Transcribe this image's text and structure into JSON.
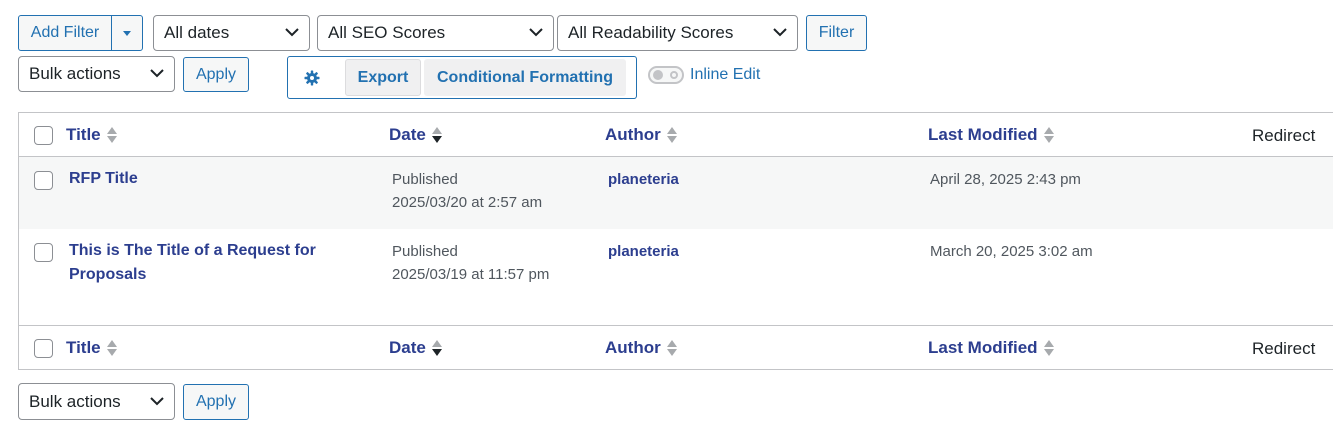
{
  "toolbar": {
    "add_filter": "Add Filter",
    "dates": "All dates",
    "seo": "All SEO Scores",
    "readability": "All Readability Scores",
    "filter": "Filter",
    "bulk_actions": "Bulk actions",
    "apply": "Apply",
    "export": "Export",
    "conditional_formatting": "Conditional Formatting",
    "inline_edit": "Inline Edit"
  },
  "columns": {
    "title": "Title",
    "date": "Date",
    "author": "Author",
    "last_modified": "Last Modified",
    "redirect": "Redirect"
  },
  "rows": [
    {
      "title": "RFP Title",
      "status": "Published",
      "date": "2025/03/20 at 2:57 am",
      "author": "planeteria",
      "modified": "April 28, 2025 2:43 pm"
    },
    {
      "title": "This is The Title of a Request for Proposals",
      "status": "Published",
      "date": "2025/03/19 at 11:57 pm",
      "author": "planeteria",
      "modified": "March 20, 2025 3:02 am"
    }
  ],
  "bottom": {
    "bulk_actions": "Bulk actions",
    "apply": "Apply"
  },
  "colors": {
    "link": "#2c3e8f",
    "button": "#2271b1",
    "border": "#c3c4c7",
    "stripe": "#f6f7f7"
  },
  "icons": [
    "caret-down-icon",
    "chevron-down-icon",
    "gear-icon",
    "sort-icon",
    "sort-desc-icon"
  ]
}
